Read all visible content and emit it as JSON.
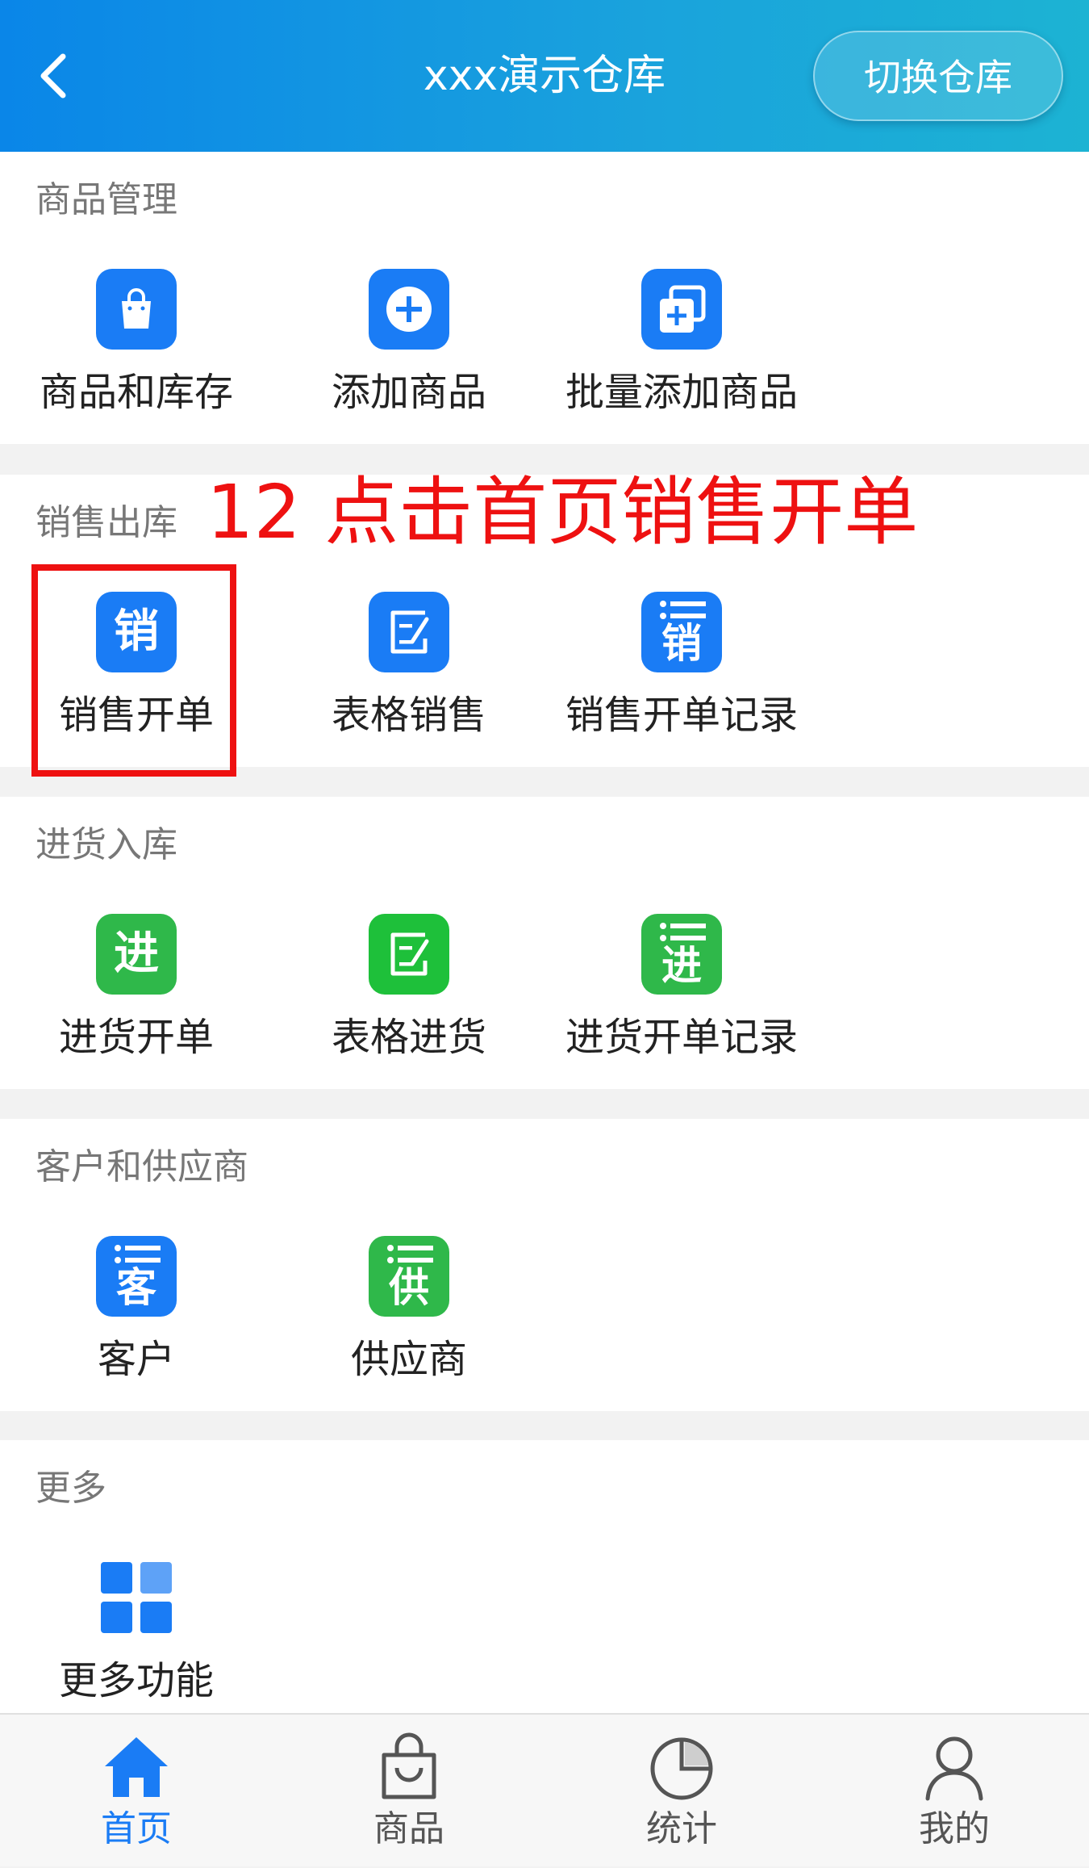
{
  "header": {
    "title": "xxx演示仓库",
    "switch_label": "切换仓库"
  },
  "sections": [
    {
      "title": "商品管理",
      "items": [
        {
          "label": "商品和库存",
          "icon": "shopping-bag-icon",
          "color": "#1a7cf5"
        },
        {
          "label": "添加商品",
          "icon": "plus-circle-icon",
          "color": "#1a7cf5"
        },
        {
          "label": "批量添加商品",
          "icon": "copy-plus-icon",
          "color": "#1a7cf5"
        }
      ]
    },
    {
      "title": "销售出库",
      "items": [
        {
          "label": "销售开单",
          "icon": "sales-order-icon",
          "glyph": "销",
          "color": "#1a7cf5"
        },
        {
          "label": "表格销售",
          "icon": "edit-sheet-icon",
          "color": "#1a7cf5"
        },
        {
          "label": "销售开单记录",
          "icon": "sales-list-icon",
          "glyph": "销",
          "color": "#1a7cf5"
        }
      ]
    },
    {
      "title": "进货入库",
      "items": [
        {
          "label": "进货开单",
          "icon": "purchase-order-icon",
          "glyph": "进",
          "color": "#2fb84a"
        },
        {
          "label": "表格进货",
          "icon": "edit-sheet-icon",
          "color": "#1ec03a"
        },
        {
          "label": "进货开单记录",
          "icon": "purchase-list-icon",
          "glyph": "进",
          "color": "#2fb84a"
        }
      ]
    },
    {
      "title": "客户和供应商",
      "items": [
        {
          "label": "客户",
          "icon": "customer-list-icon",
          "glyph": "客",
          "color": "#1a7cf5"
        },
        {
          "label": "供应商",
          "icon": "supplier-list-icon",
          "glyph": "供",
          "color": "#2fb84a"
        }
      ]
    },
    {
      "title": "更多",
      "items": [
        {
          "label": "更多功能",
          "icon": "grid-icon",
          "color": "#1a7cf5"
        }
      ]
    }
  ],
  "annotation": "12 点击首页销售开单",
  "tabbar": [
    {
      "label": "首页",
      "icon": "home-icon",
      "active": true
    },
    {
      "label": "商品",
      "icon": "bag-icon",
      "active": false
    },
    {
      "label": "统计",
      "icon": "pie-chart-icon",
      "active": false
    },
    {
      "label": "我的",
      "icon": "user-icon",
      "active": false
    }
  ],
  "colors": {
    "accent": "#1a7cf5",
    "green": "#2fb84a",
    "annotation": "#ee1111"
  }
}
